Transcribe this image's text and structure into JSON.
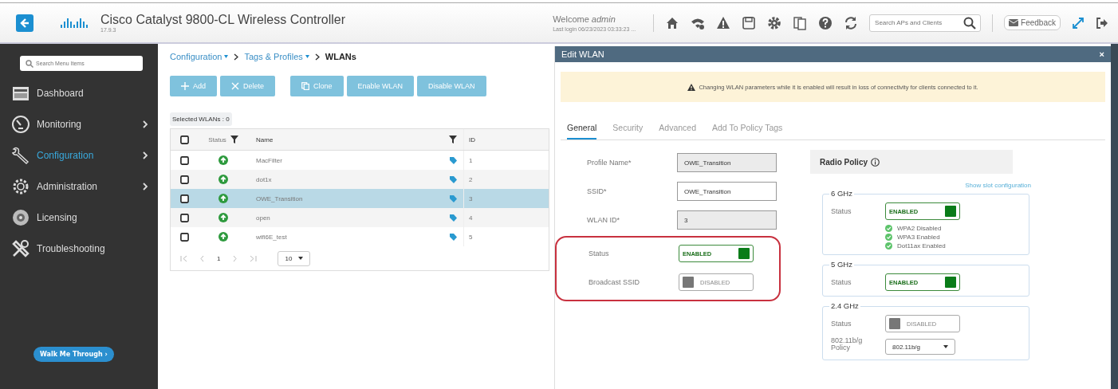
{
  "header": {
    "title": "Cisco Catalyst 9800-CL Wireless Controller",
    "version": "17.9.3",
    "welcome": "Welcome",
    "user": "admin",
    "last_login": "Last login 06/23/2023 03:33:23 ...",
    "search_placeholder": "Search APs and Clients",
    "feedback": "Feedback"
  },
  "sidebar": {
    "search_placeholder": "Search Menu Items",
    "items": [
      {
        "label": "Dashboard",
        "selected": false,
        "arrow": false
      },
      {
        "label": "Monitoring",
        "selected": false,
        "arrow": true
      },
      {
        "label": "Configuration",
        "selected": true,
        "arrow": true
      },
      {
        "label": "Administration",
        "selected": false,
        "arrow": true
      },
      {
        "label": "Licensing",
        "selected": false,
        "arrow": false
      },
      {
        "label": "Troubleshooting",
        "selected": false,
        "arrow": false
      }
    ],
    "walk_me": "Walk Me Through ›"
  },
  "breadcrumb": [
    {
      "label": "Configuration",
      "dropdown": true
    },
    {
      "label": "Tags & Profiles",
      "dropdown": true
    },
    {
      "label": "WLANs",
      "dropdown": false
    }
  ],
  "actions": [
    {
      "label": "Add",
      "disabled": true
    },
    {
      "label": "Delete",
      "disabled": true
    },
    {
      "label": "Clone",
      "disabled": true
    },
    {
      "label": "Enable WLAN",
      "disabled": true
    },
    {
      "label": "Disable WLAN",
      "disabled": true
    }
  ],
  "selected_count": "Selected WLANs : 0",
  "table": {
    "columns": [
      "Status",
      "Name",
      "ID"
    ],
    "all_checked": false,
    "rows": [
      {
        "name": "MacFilter",
        "id": "1",
        "checked": false,
        "selected": false
      },
      {
        "name": "dot1x",
        "id": "2",
        "checked": false,
        "selected": false
      },
      {
        "name": "OWE_Transition",
        "id": "3",
        "checked": false,
        "selected": true
      },
      {
        "name": "open",
        "id": "4",
        "checked": false,
        "selected": false
      },
      {
        "name": "wifi6E_test",
        "id": "5",
        "checked": false,
        "selected": false
      }
    ],
    "pager": {
      "page": "1",
      "page_size": "10"
    }
  },
  "edit": {
    "title": "Edit WLAN",
    "close": "×",
    "warning": "Changing WLAN parameters while it is enabled will result in loss of connectivity for clients connected to it.",
    "tabs": [
      {
        "label": "General",
        "selected": true
      },
      {
        "label": "Security",
        "selected": false
      },
      {
        "label": "Advanced",
        "selected": false
      },
      {
        "label": "Add To Policy Tags",
        "selected": false
      }
    ],
    "fields": [
      {
        "label": "Profile Name*",
        "kind": "readonly",
        "value": "OWE_Transition"
      },
      {
        "label": "SSID*",
        "kind": "input",
        "value": "OWE_Transition"
      },
      {
        "label": "WLAN ID*",
        "kind": "readonly",
        "value": "3"
      }
    ],
    "annotated_fields": [
      {
        "label": "Status",
        "kind": "toggle",
        "value": "ENABLED",
        "on": true
      },
      {
        "label": "Broadcast SSID",
        "kind": "toggle",
        "value": "DISABLED",
        "on": false
      }
    ],
    "radio_policy": {
      "title": "Radio Policy",
      "link": "Show slot configuration",
      "bands": [
        {
          "name": "6 GHz",
          "status_label": "Status",
          "status": "ENABLED",
          "on": true,
          "notes": [
            "WPA2 Disabled",
            "WPA3 Enabled",
            "Dot11ax Enabled"
          ]
        },
        {
          "name": "5 GHz",
          "status_label": "Status",
          "status": "ENABLED",
          "on": true
        },
        {
          "name": "2.4 GHz",
          "status_label": "Status",
          "status": "DISABLED",
          "on": false,
          "policy_label": "802.11b/g Policy",
          "policy_value": "802.11b/g"
        }
      ]
    }
  }
}
